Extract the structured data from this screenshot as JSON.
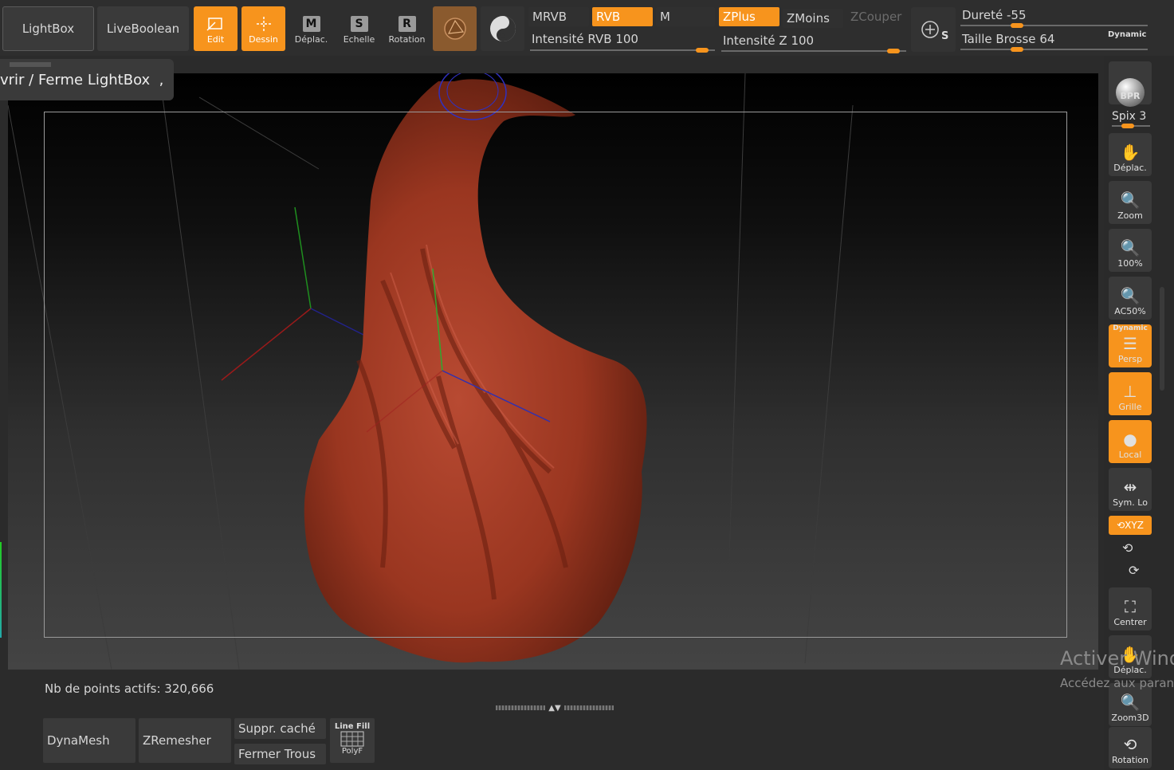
{
  "topbar": {
    "lightbox": "LightBox",
    "liveboolean": "LiveBoolean",
    "edit": "Edit",
    "draw": "Dessin",
    "move": "Déplac.",
    "scale": "Echelle",
    "rotate": "Rotation",
    "move_glyph": "M",
    "scale_glyph": "S",
    "rotate_glyph": "R",
    "mrgb": "MRVB",
    "rgb": "RVB",
    "m": "M",
    "zadd": "ZPlus",
    "zsub": "ZMoins",
    "zcut": "ZCouper",
    "rgb_intensity_label": "Intensité RVB",
    "rgb_intensity_value": "100",
    "z_intensity_label": "Intensité Z",
    "z_intensity_value": "100",
    "hardness_label": "Dureté",
    "hardness_value": "-55",
    "brush_size_label": "Taille Brosse",
    "brush_size_value": "64",
    "dynamic": "Dynamic",
    "rgb_intensity_level": 0.93,
    "z_intensity_level": 0.93,
    "hardness_level": 0.3,
    "brush_size_level": 0.3
  },
  "tooltip": "vrir / Ferme LightBox  ,",
  "shelf": {
    "bpr": "BPR",
    "spix_label": "Spix",
    "spix_value": "3",
    "move": "Déplac.",
    "zoom": "Zoom",
    "actual": "100%",
    "actual_half": "AC50%",
    "persp_top": "Dynamic",
    "persp": "Persp",
    "floor": "Grille",
    "local": "Local",
    "sym": "Sym. Lo",
    "xyz": "XYZ",
    "center": "Centrer",
    "move2": "Déplac.",
    "zoom3d": "Zoom3D",
    "rotation": "Rotation"
  },
  "status": {
    "points_label": "Nb de points actifs:",
    "points_value": "320,666"
  },
  "bottom": {
    "dynamesh": "DynaMesh",
    "zremesher": "ZRemesher",
    "del_hidden": "Suppr. caché",
    "close_holes": "Fermer Trous",
    "linefill_top": "Line Fill",
    "linefill_bottom": "PolyF"
  },
  "watermark": {
    "line1": "Activer Windo",
    "line2": "Accédez aux paran"
  },
  "colors": {
    "accent": "#f7941d",
    "background": "#2b2b2b",
    "mesh": "#9e3a24"
  }
}
